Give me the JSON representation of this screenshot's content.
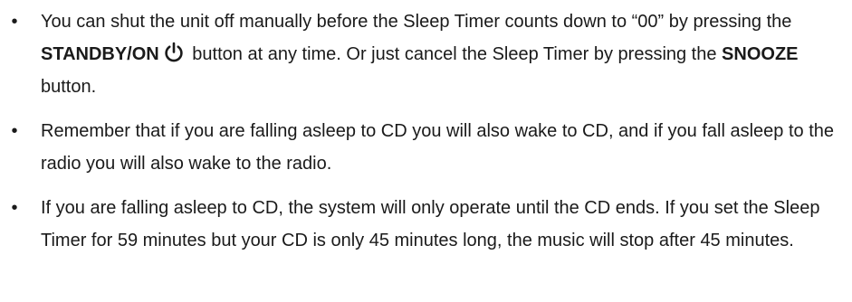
{
  "bullets": [
    {
      "text_1": "You can shut the unit off manually before the Sleep Timer counts down to “00” by pressing the ",
      "bold_1": "STANDBY/ON",
      "icon": "power-icon",
      "text_2": " button at any time. Or just cancel the Sleep Timer by pressing the ",
      "bold_2": "SNOOZE",
      "text_3": " button."
    },
    {
      "text": "Remember that if you are falling asleep to CD you will also wake to CD, and if you fall asleep to the radio you will also wake to the radio."
    },
    {
      "text": "If you are falling asleep to CD, the system will only operate until the CD ends. If you set the Sleep Timer for 59 minutes but your CD is only 45 minutes long, the music will stop after 45 minutes."
    }
  ]
}
